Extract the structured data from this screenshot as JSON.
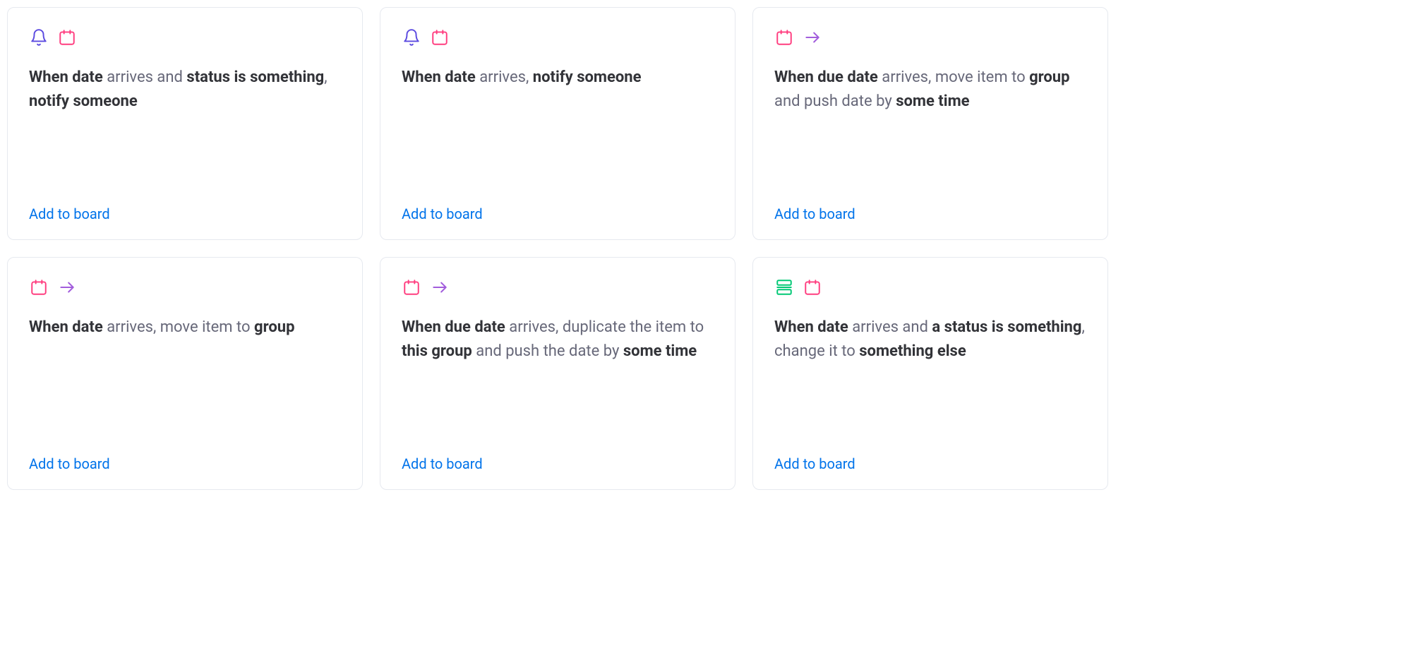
{
  "action_label": "Add to board",
  "colors": {
    "bell": "#5b4ae0",
    "calendar": "#ff3d7f",
    "arrow": "#a25ddc",
    "status": "#00c875"
  },
  "cards": [
    {
      "icons": [
        "bell",
        "calendar"
      ],
      "parts": [
        {
          "t": "When",
          "b": true
        },
        {
          "t": " "
        },
        {
          "t": "date",
          "b": true
        },
        {
          "t": " arrives and ",
          "b": false
        },
        {
          "t": "status",
          "b": true
        },
        {
          "t": " "
        },
        {
          "t": "is something",
          "b": true
        },
        {
          "t": ", ",
          "b": false
        },
        {
          "t": "notify",
          "b": true
        },
        {
          "t": " "
        },
        {
          "t": "someone",
          "b": true
        }
      ]
    },
    {
      "icons": [
        "bell",
        "calendar"
      ],
      "parts": [
        {
          "t": "When",
          "b": true
        },
        {
          "t": " "
        },
        {
          "t": "date",
          "b": true
        },
        {
          "t": " arrives, ",
          "b": false
        },
        {
          "t": "notify",
          "b": true
        },
        {
          "t": " "
        },
        {
          "t": "someone",
          "b": true
        }
      ]
    },
    {
      "icons": [
        "calendar",
        "arrow"
      ],
      "parts": [
        {
          "t": "When",
          "b": true
        },
        {
          "t": " "
        },
        {
          "t": "due date",
          "b": true
        },
        {
          "t": " arrives, move item to ",
          "b": false
        },
        {
          "t": "group",
          "b": true
        },
        {
          "t": " and push date by ",
          "b": false
        },
        {
          "t": "some time",
          "b": true
        }
      ]
    },
    {
      "icons": [
        "calendar",
        "arrow"
      ],
      "parts": [
        {
          "t": "When",
          "b": true
        },
        {
          "t": " "
        },
        {
          "t": "date",
          "b": true
        },
        {
          "t": " arrives, move item to ",
          "b": false
        },
        {
          "t": "group",
          "b": true
        }
      ]
    },
    {
      "icons": [
        "calendar",
        "arrow"
      ],
      "parts": [
        {
          "t": "When",
          "b": true
        },
        {
          "t": " "
        },
        {
          "t": "due date",
          "b": true
        },
        {
          "t": " arrives, duplicate the item to ",
          "b": false
        },
        {
          "t": "this group",
          "b": true
        },
        {
          "t": " and push the date by ",
          "b": false
        },
        {
          "t": "some time",
          "b": true
        }
      ]
    },
    {
      "icons": [
        "status",
        "calendar"
      ],
      "parts": [
        {
          "t": "When",
          "b": true
        },
        {
          "t": " "
        },
        {
          "t": "date",
          "b": true
        },
        {
          "t": " arrives and ",
          "b": false
        },
        {
          "t": "a status",
          "b": true
        },
        {
          "t": " "
        },
        {
          "t": "is something",
          "b": true
        },
        {
          "t": ", change it to ",
          "b": false
        },
        {
          "t": "something else",
          "b": true
        }
      ]
    }
  ]
}
